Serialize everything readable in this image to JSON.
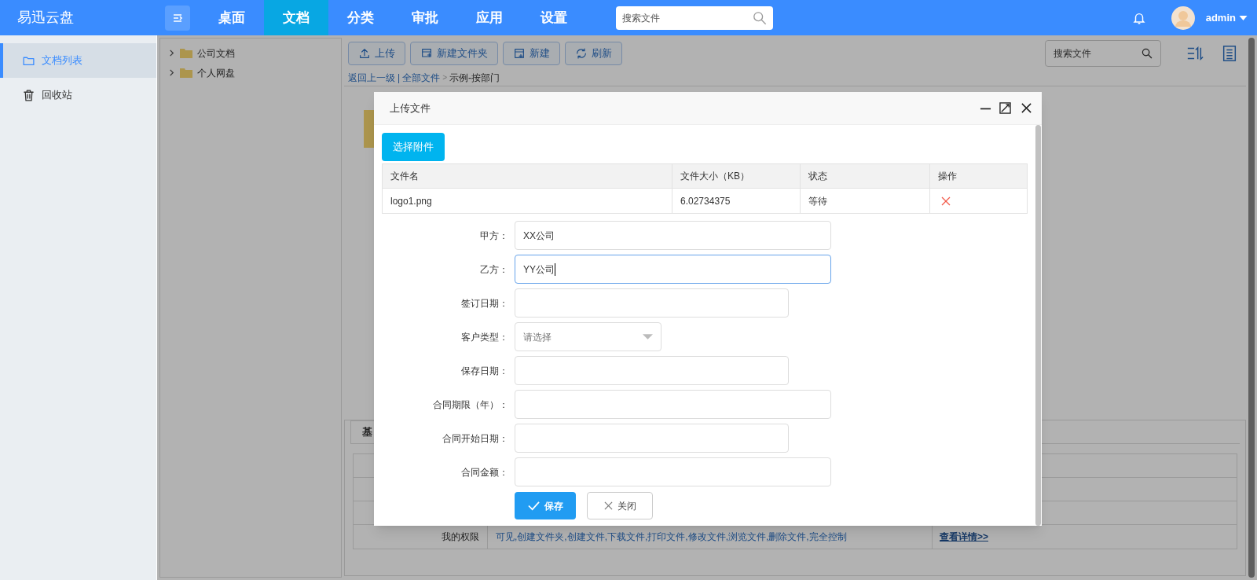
{
  "app": {
    "title": "易迅云盘"
  },
  "nav": [
    {
      "label": "桌面",
      "selected": false
    },
    {
      "label": "文档",
      "selected": true
    },
    {
      "label": "分类",
      "selected": false
    },
    {
      "label": "审批",
      "selected": false
    },
    {
      "label": "应用",
      "selected": false
    },
    {
      "label": "设置",
      "selected": false
    }
  ],
  "search": {
    "placeholder": "搜索文件"
  },
  "user": {
    "name": "admin"
  },
  "sidebar": [
    {
      "label": "文档列表",
      "selected": true
    },
    {
      "label": "回收站",
      "selected": false
    }
  ],
  "tree": [
    {
      "label": "公司文档",
      "expanded": false
    },
    {
      "label": "个人网盘",
      "expanded": false
    }
  ],
  "toolbar": [
    {
      "label": "上传",
      "kind": "upload"
    },
    {
      "label": "新建文件夹",
      "kind": "folder"
    },
    {
      "label": "新建",
      "kind": "new"
    },
    {
      "label": "刷新",
      "kind": "refresh"
    }
  ],
  "breadcrumb": [
    {
      "label": "返回上一级",
      "kind": "link"
    },
    {
      "label": "|",
      "kind": "separator"
    },
    {
      "label": "全部文件",
      "kind": "link"
    },
    {
      "label": ">",
      "kind": "arrow"
    },
    {
      "label": "示例-按部门",
      "kind": "current"
    }
  ],
  "content_search": {
    "placeholder": "搜索文件"
  },
  "detail": {
    "tabs": [
      {
        "label": "基",
        "selected": true
      }
    ],
    "rows": [
      {},
      {},
      {},
      {
        "label": "我的权限",
        "value": "可见,创建文件夹,创建文件,下载文件,打印文件,修改文件,浏览文件,删除文件,完全控制",
        "link": "查看详情>>"
      }
    ]
  },
  "dialog": {
    "title": "上传文件",
    "choose_button": "选择附件",
    "table": {
      "columns": [
        "文件名",
        "文件大小（KB）",
        "状态",
        "操作"
      ],
      "rows": [
        {
          "name": "logo1.png",
          "size": "6.02734375",
          "status": "等待"
        }
      ]
    },
    "fields": [
      {
        "label": "甲方：",
        "kind": "text",
        "value": "XX公司",
        "focused": false
      },
      {
        "label": "乙方：",
        "kind": "text",
        "value": "YY公司",
        "focused": true
      },
      {
        "label": "签订日期：",
        "kind": "date",
        "focused": false
      },
      {
        "label": "客户类型：",
        "kind": "select",
        "placeholder": "请选择",
        "focused": false
      },
      {
        "label": "保存日期：",
        "kind": "date",
        "focused": false
      },
      {
        "label": "合同期限（年）：",
        "kind": "text",
        "focused": false
      },
      {
        "label": "合同开始日期：",
        "kind": "date",
        "focused": false
      },
      {
        "label": "合同金额：",
        "kind": "text",
        "focused": false
      }
    ],
    "buttons": [
      {
        "label": "保存",
        "kind": "primary"
      },
      {
        "label": "关闭",
        "kind": "secondary"
      }
    ]
  }
}
